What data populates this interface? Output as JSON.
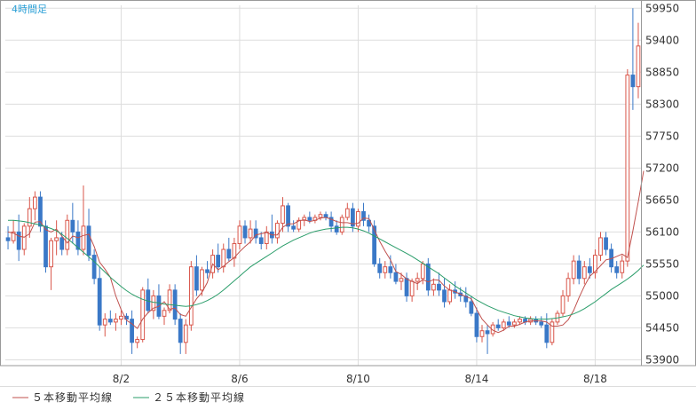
{
  "timeframe_label": "4時間足",
  "colors": {
    "up": "#d9564a",
    "down": "#3a78c7",
    "ma5": "#c0504d",
    "ma25": "#2a9d6a",
    "grid": "#dddddd",
    "axis": "#999999",
    "timeframe_text": "#2a9fd6"
  },
  "legend": [
    {
      "label": "５本移動平均線",
      "color": "#c0504d"
    },
    {
      "label": "２５本移動平均線",
      "color": "#2a9d6a"
    }
  ],
  "chart_data": {
    "type": "candlestick",
    "title": "",
    "xlabel": "",
    "ylabel": "",
    "grid": true,
    "ylim": [
      53800,
      60000
    ],
    "y_ticks": [
      53900,
      54450,
      55000,
      55550,
      56100,
      56650,
      57200,
      57750,
      58300,
      58850,
      59400,
      59950
    ],
    "x_ticks": [
      "8/2",
      "8/6",
      "8/10",
      "8/14",
      "8/18"
    ],
    "x_tick_index": [
      21,
      43,
      65,
      87,
      109
    ],
    "candles": [
      [
        56000,
        56200,
        55800,
        55950
      ],
      [
        55950,
        56300,
        55900,
        56100
      ],
      [
        56100,
        56400,
        55600,
        55800
      ],
      [
        55800,
        56250,
        55700,
        56200
      ],
      [
        56200,
        56700,
        56000,
        56500
      ],
      [
        56500,
        56800,
        56300,
        56700
      ],
      [
        56700,
        56800,
        56100,
        56200
      ],
      [
        56200,
        56300,
        55400,
        55500
      ],
      [
        55500,
        56000,
        55100,
        55950
      ],
      [
        55950,
        56300,
        55700,
        56000
      ],
      [
        56000,
        56100,
        55700,
        55800
      ],
      [
        55800,
        56400,
        55700,
        56300
      ],
      [
        56300,
        56600,
        55900,
        56100
      ],
      [
        56100,
        56300,
        55700,
        55800
      ],
      [
        55800,
        56900,
        55700,
        56200
      ],
      [
        56200,
        56500,
        55600,
        55700
      ],
      [
        55700,
        55800,
        55200,
        55300
      ],
      [
        55300,
        55500,
        54400,
        54500
      ],
      [
        54500,
        54700,
        54300,
        54600
      ],
      [
        54600,
        54750,
        54500,
        54550
      ],
      [
        54550,
        54700,
        54400,
        54600
      ],
      [
        54600,
        54750,
        54500,
        54650
      ],
      [
        54650,
        54700,
        54500,
        54600
      ],
      [
        54600,
        54750,
        54000,
        54200
      ],
      [
        54200,
        54300,
        54100,
        54250
      ],
      [
        54250,
        55150,
        54200,
        55100
      ],
      [
        55100,
        55300,
        54700,
        54750
      ],
      [
        54750,
        55100,
        54600,
        55000
      ],
      [
        55000,
        55200,
        54600,
        54650
      ],
      [
        54650,
        54800,
        54500,
        54750
      ],
      [
        54750,
        55200,
        54700,
        55100
      ],
      [
        55100,
        55200,
        54500,
        54600
      ],
      [
        54600,
        54700,
        54000,
        54200
      ],
      [
        54200,
        54600,
        54000,
        54500
      ],
      [
        54500,
        55600,
        54400,
        55500
      ],
      [
        55500,
        55700,
        55000,
        55100
      ],
      [
        55100,
        55500,
        55000,
        55450
      ],
      [
        55450,
        55600,
        55300,
        55400
      ],
      [
        55400,
        55800,
        55300,
        55700
      ],
      [
        55700,
        55900,
        55400,
        55500
      ],
      [
        55500,
        55900,
        55400,
        55800
      ],
      [
        55800,
        56000,
        55600,
        55650
      ],
      [
        55650,
        56000,
        55500,
        55900
      ],
      [
        55900,
        56300,
        55800,
        56200
      ],
      [
        56200,
        56300,
        55900,
        56000
      ],
      [
        56000,
        56300,
        55900,
        56150
      ],
      [
        56150,
        56300,
        55900,
        56000
      ],
      [
        56000,
        56100,
        55800,
        55900
      ],
      [
        55900,
        56200,
        55800,
        56100
      ],
      [
        56100,
        56400,
        55900,
        56000
      ],
      [
        56000,
        56300,
        55900,
        56250
      ],
      [
        56250,
        56700,
        56100,
        56550
      ],
      [
        56550,
        56600,
        56100,
        56200
      ],
      [
        56200,
        56300,
        56100,
        56150
      ],
      [
        56150,
        56350,
        56100,
        56300
      ],
      [
        56300,
        56400,
        56200,
        56350
      ],
      [
        56350,
        56450,
        56250,
        56300
      ],
      [
        56300,
        56400,
        56250,
        56350
      ],
      [
        56350,
        56450,
        56300,
        56400
      ],
      [
        56400,
        56450,
        56300,
        56350
      ],
      [
        56350,
        56450,
        56100,
        56200
      ],
      [
        56200,
        56300,
        56050,
        56100
      ],
      [
        56100,
        56400,
        56050,
        56350
      ],
      [
        56350,
        56600,
        56300,
        56500
      ],
      [
        56500,
        56600,
        56100,
        56200
      ],
      [
        56200,
        56500,
        56100,
        56450
      ],
      [
        56450,
        56600,
        56200,
        56300
      ],
      [
        56300,
        56400,
        56100,
        56200
      ],
      [
        56200,
        56300,
        55500,
        55550
      ],
      [
        55550,
        55650,
        55300,
        55400
      ],
      [
        55400,
        55600,
        55300,
        55500
      ],
      [
        55500,
        55700,
        55300,
        55400
      ],
      [
        55400,
        55550,
        55200,
        55250
      ],
      [
        55250,
        55400,
        55100,
        55300
      ],
      [
        55300,
        55400,
        54900,
        55000
      ],
      [
        55000,
        55300,
        54900,
        55250
      ],
      [
        55250,
        55400,
        55100,
        55300
      ],
      [
        55300,
        55600,
        55200,
        55550
      ],
      [
        55550,
        55650,
        55000,
        55100
      ],
      [
        55100,
        55300,
        55000,
        55200
      ],
      [
        55200,
        55400,
        55000,
        55100
      ],
      [
        55100,
        55300,
        54800,
        54900
      ],
      [
        54900,
        55200,
        54850,
        55100
      ],
      [
        55100,
        55250,
        54950,
        55050
      ],
      [
        55050,
        55150,
        54900,
        55000
      ],
      [
        55000,
        55150,
        54800,
        54900
      ],
      [
        54900,
        55000,
        54650,
        54700
      ],
      [
        54700,
        54800,
        54200,
        54300
      ],
      [
        54300,
        54500,
        54200,
        54400
      ],
      [
        54400,
        54500,
        54000,
        54350
      ],
      [
        54350,
        54550,
        54300,
        54500
      ],
      [
        54500,
        54600,
        54400,
        54450
      ],
      [
        54450,
        54600,
        54400,
        54550
      ],
      [
        54550,
        54650,
        54450,
        54500
      ],
      [
        54500,
        54600,
        54450,
        54550
      ],
      [
        54550,
        54650,
        54500,
        54600
      ],
      [
        54600,
        54650,
        54500,
        54550
      ],
      [
        54550,
        54650,
        54500,
        54600
      ],
      [
        54600,
        54650,
        54500,
        54550
      ],
      [
        54550,
        54650,
        54450,
        54500
      ],
      [
        54500,
        54700,
        54100,
        54200
      ],
      [
        54200,
        54600,
        54150,
        54550
      ],
      [
        54550,
        54750,
        54500,
        54700
      ],
      [
        54700,
        55100,
        54650,
        55000
      ],
      [
        55000,
        55400,
        54900,
        55300
      ],
      [
        55300,
        55700,
        55200,
        55600
      ],
      [
        55600,
        55700,
        55200,
        55300
      ],
      [
        55300,
        55600,
        55200,
        55500
      ],
      [
        55500,
        55650,
        55300,
        55400
      ],
      [
        55400,
        55800,
        55300,
        55700
      ],
      [
        55700,
        56100,
        55600,
        56000
      ],
      [
        56000,
        56100,
        55700,
        55800
      ],
      [
        55800,
        55900,
        55400,
        55500
      ],
      [
        55500,
        55600,
        55300,
        55400
      ],
      [
        55400,
        55700,
        55300,
        55600
      ],
      [
        55600,
        58900,
        55500,
        58800
      ],
      [
        58800,
        59950,
        58200,
        58600
      ],
      [
        58600,
        59700,
        58400,
        59300
      ]
    ],
    "series": [
      {
        "name": "５本移動平均線",
        "values": [
          56100,
          56080,
          56030,
          56010,
          56070,
          56270,
          56280,
          56140,
          56100,
          56150,
          56030,
          55910,
          56030,
          56000,
          56040,
          56060,
          55850,
          55580,
          55460,
          55320,
          55000,
          54760,
          54580,
          54520,
          54440,
          54600,
          54710,
          54790,
          54820,
          54900,
          54770,
          54790,
          54680,
          54650,
          54800,
          54950,
          55060,
          55230,
          55550,
          55450,
          55510,
          55590,
          55660,
          55760,
          55850,
          55930,
          56050,
          56070,
          56090,
          56050,
          56050,
          56180,
          56240,
          56240,
          56290,
          56310,
          56280,
          56300,
          56340,
          56350,
          56320,
          56280,
          56260,
          56260,
          56240,
          56250,
          56340,
          56330,
          56140,
          55940,
          55770,
          55620,
          55420,
          55370,
          55290,
          55250,
          55210,
          55280,
          55240,
          55280,
          55270,
          55170,
          55100,
          55070,
          55030,
          54990,
          54950,
          54770,
          54600,
          54500,
          54410,
          54370,
          54410,
          54480,
          54480,
          54510,
          54550,
          54570,
          54570,
          54570,
          54550,
          54480,
          54480,
          54500,
          54590,
          54750,
          54970,
          55170,
          55340,
          55420,
          55520,
          55620,
          55640,
          55680,
          55720,
          55660,
          56120,
          56620,
          57150
        ]
      },
      {
        "name": "２５本移動平均線",
        "values": [
          56300,
          56300,
          56290,
          56280,
          56260,
          56240,
          56220,
          56190,
          56160,
          56120,
          56060,
          55990,
          55910,
          55830,
          55750,
          55670,
          55590,
          55500,
          55410,
          55320,
          55240,
          55160,
          55090,
          55030,
          54980,
          54940,
          54910,
          54890,
          54880,
          54860,
          54850,
          54840,
          54830,
          54820,
          54830,
          54850,
          54880,
          54920,
          54970,
          55030,
          55100,
          55180,
          55260,
          55340,
          55420,
          55500,
          55560,
          55620,
          55680,
          55740,
          55800,
          55860,
          55910,
          55960,
          56000,
          56040,
          56080,
          56110,
          56130,
          56150,
          56160,
          56170,
          56180,
          56180,
          56170,
          56150,
          56120,
          56080,
          56030,
          55980,
          55930,
          55880,
          55830,
          55780,
          55730,
          55680,
          55620,
          55560,
          55500,
          55440,
          55380,
          55310,
          55240,
          55170,
          55110,
          55050,
          54990,
          54930,
          54880,
          54830,
          54790,
          54750,
          54720,
          54690,
          54660,
          54640,
          54620,
          54610,
          54600,
          54600,
          54600,
          54610,
          54620,
          54640,
          54660,
          54690,
          54730,
          54780,
          54840,
          54900,
          54970,
          55040,
          55110,
          55170,
          55230,
          55290,
          55360,
          55440,
          55530
        ]
      }
    ]
  }
}
